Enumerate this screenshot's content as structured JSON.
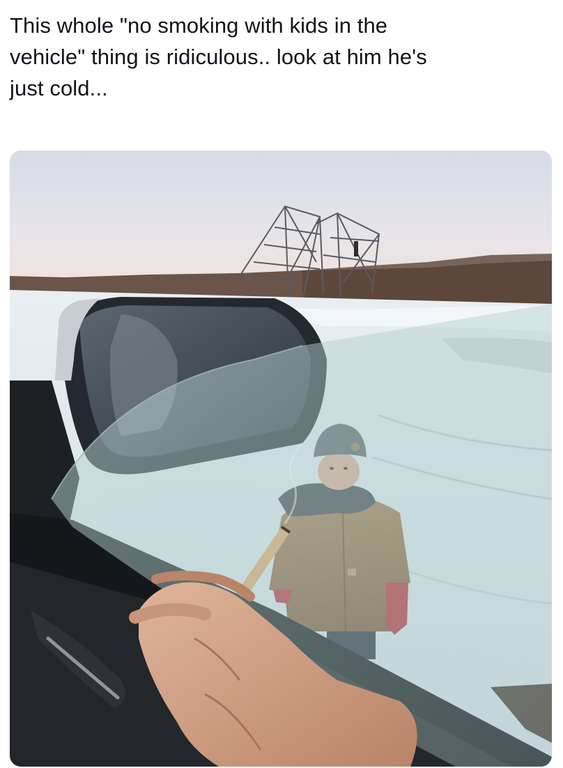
{
  "post": {
    "caption_lines": [
      "This whole \"no smoking with kids in the",
      "vehicle\" thing is ridiculous.. look at him he's",
      "just cold..."
    ],
    "image_alt": "Photo from inside a car: a hand holding a joint outside the car window, with a small child in a brown jacket and knit hat standing in the snow outside; a side mirror and a metal tower frame in the background"
  }
}
